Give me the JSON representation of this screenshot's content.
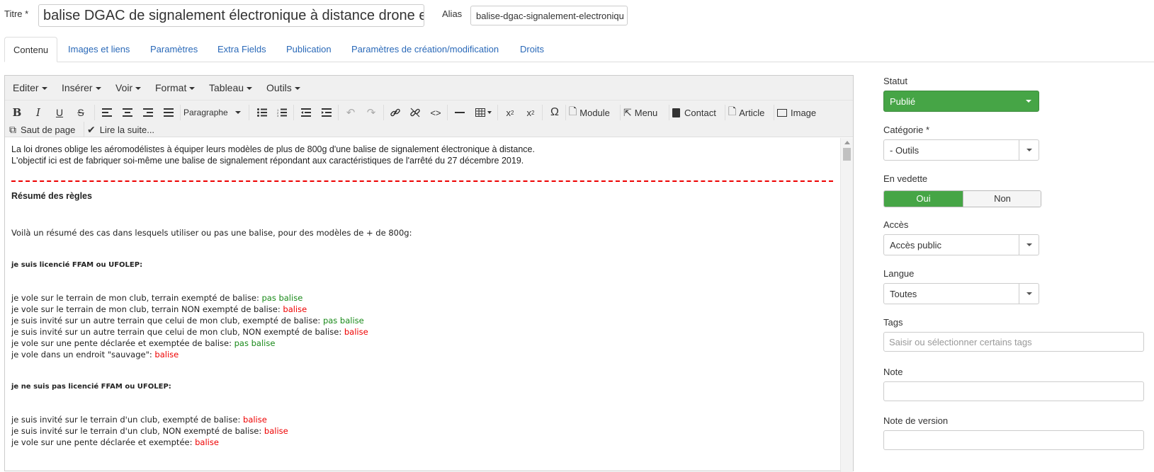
{
  "title_field": {
    "label": "Titre *",
    "value": "balise DGAC de signalement électronique à distance drone et aéro"
  },
  "alias_field": {
    "label": "Alias",
    "value": "balise-dgac-signalement-electroniqu"
  },
  "tabs": [
    "Contenu",
    "Images et liens",
    "Paramètres",
    "Extra Fields",
    "Publication",
    "Paramètres de création/modification",
    "Droits"
  ],
  "editor": {
    "menus": [
      "Editer",
      "Insérer",
      "Voir",
      "Format",
      "Tableau",
      "Outils"
    ],
    "format_select": "Paragraphe",
    "buttons": {
      "module": "Module",
      "menu": "Menu",
      "contact": "Contact",
      "article": "Article",
      "image": "Image",
      "pagebreak": "Saut de page",
      "readmore": "Lire la suite..."
    },
    "content": {
      "intro1": "La loi drones oblige les aéromodélistes à équiper leurs modèles de plus de 800g d'une balise de signalement électronique à distance.",
      "intro2": "L'objectif ici est de fabriquer soi-même une balise de signalement répondant aux caractéristiques de l'arrêté du 27 décembre 2019.",
      "rules_heading": "Résumé des règles",
      "summary": "Voilà un résumé des cas dans lesquels utiliser ou pas une balise, pour des modèles de + de 800g:",
      "section1_heading": "je suis licencié FFAM ou UFOLEP:",
      "section1_lines": [
        {
          "text": "je vole sur le terrain de mon club, terrain exempté de balise: ",
          "result": "pas balise",
          "color": "#1a8a1a"
        },
        {
          "text": "je vole sur le terrain de mon club, terrain NON exempté de balise: ",
          "result": "balise",
          "color": "#e00000"
        },
        {
          "text": "je suis invité sur un autre terrain que celui de mon club, exempté de balise: ",
          "result": "pas balise",
          "color": "#1a8a1a"
        },
        {
          "text": "je suis invité sur un autre terrain que celui de mon club, NON exempté de balise: ",
          "result": "balise",
          "color": "#e00000"
        },
        {
          "text": "je vole sur une pente déclarée et exemptée de balise: ",
          "result": "pas balise",
          "color": "#1a8a1a"
        },
        {
          "text": "je vole dans un endroit \"sauvage\": ",
          "result": "balise",
          "color": "#e00000"
        }
      ],
      "section2_heading": "je ne suis pas licencié FFAM ou UFOLEP:",
      "section2_lines": [
        {
          "text": "je suis invité sur le terrain d'un club, exempté de balise: ",
          "result": "balise",
          "color": "#e00000"
        },
        {
          "text": "je suis invité sur le terrain d'un club, NON exempté de balise: ",
          "result": "balise",
          "color": "#e00000"
        },
        {
          "text": "je vole sur une pente déclarée et exemptée: ",
          "result": "balise",
          "color": "#e00000"
        }
      ]
    }
  },
  "sidebar": {
    "statut": {
      "label": "Statut",
      "value": "Publié"
    },
    "categorie": {
      "label": "Catégorie *",
      "value": "- Outils"
    },
    "vedette": {
      "label": "En vedette",
      "yes": "Oui",
      "no": "Non"
    },
    "acces": {
      "label": "Accès",
      "value": "Accès public"
    },
    "langue": {
      "label": "Langue",
      "value": "Toutes"
    },
    "tags": {
      "label": "Tags",
      "placeholder": "Saisir ou sélectionner certains tags"
    },
    "note": {
      "label": "Note",
      "value": ""
    },
    "note_version": {
      "label": "Note de version",
      "value": ""
    }
  }
}
